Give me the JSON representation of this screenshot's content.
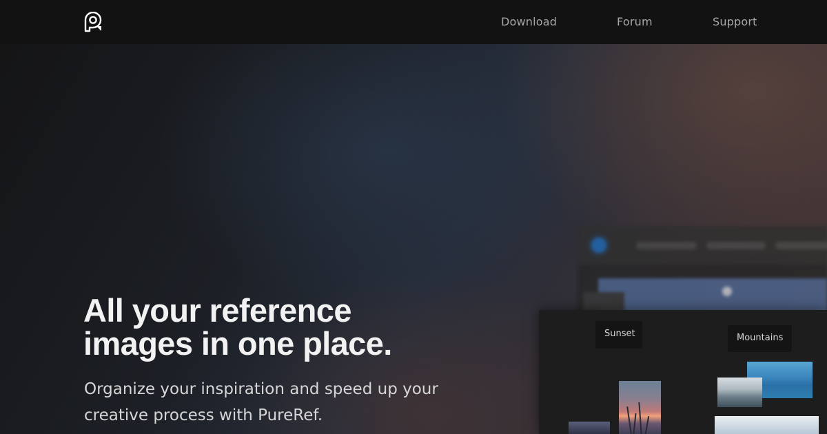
{
  "nav": {
    "items": [
      {
        "label": "Download"
      },
      {
        "label": "Forum"
      },
      {
        "label": "Support"
      }
    ]
  },
  "logo": {
    "icon": "pureref-logo-icon"
  },
  "hero": {
    "headline_line1": "All your reference",
    "headline_line2": "images in one place.",
    "subtitle_line1": "Organize your inspiration and speed up your",
    "subtitle_line2": "creative process with PureRef."
  },
  "canvas": {
    "groups": [
      {
        "label": "Sunset"
      },
      {
        "label": "Mountains"
      }
    ]
  },
  "colors": {
    "topbar": "#121212",
    "nav_text": "#a7a7a7",
    "headline": "#f2f2f2",
    "panel": "#1d1d1d"
  }
}
